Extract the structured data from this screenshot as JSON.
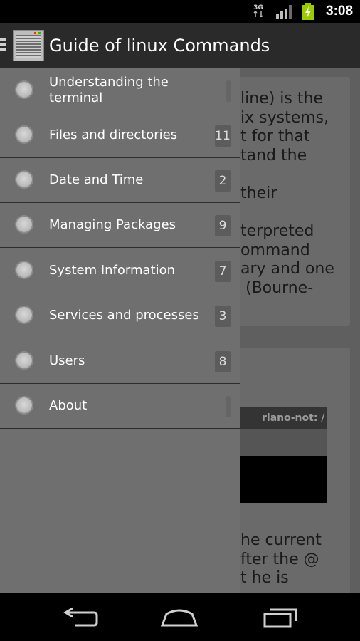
{
  "status_bar": {
    "network_label": "3G",
    "time": "3:08",
    "icons": [
      "network-3g-icon",
      "signal-icon",
      "battery-charging-icon"
    ]
  },
  "action_bar": {
    "title": "Guide of linux Commands",
    "icons": [
      "menu-icon",
      "app-icon"
    ]
  },
  "drawer": {
    "items": [
      {
        "label": "Understanding the terminal",
        "count": ""
      },
      {
        "label": "Files and directories",
        "count": "11"
      },
      {
        "label": "Date and Time",
        "count": "2"
      },
      {
        "label": "Managing Packages",
        "count": "9"
      },
      {
        "label": "System Information",
        "count": "7"
      },
      {
        "label": "Services and processes",
        "count": "3"
      },
      {
        "label": "Users",
        "count": "8"
      },
      {
        "label": "About",
        "count": ""
      }
    ]
  },
  "background_content": {
    "card1_text": "line) is the\nix systems,\nt for that\ntand the\n\ntheir\n\nterpreted\nommand\nary and one\n (Bourne-",
    "terminal_header": "riano-not: /",
    "card3_text": "he current\nfter the @\nt he is"
  },
  "nav_bar": {
    "icons": [
      "back-icon",
      "home-icon",
      "recent-apps-icon"
    ]
  },
  "colors": {
    "status_bar": "#000000",
    "action_bar": "#2a2a2a",
    "drawer": "#6f6f6f",
    "nav_bar": "#000000"
  }
}
